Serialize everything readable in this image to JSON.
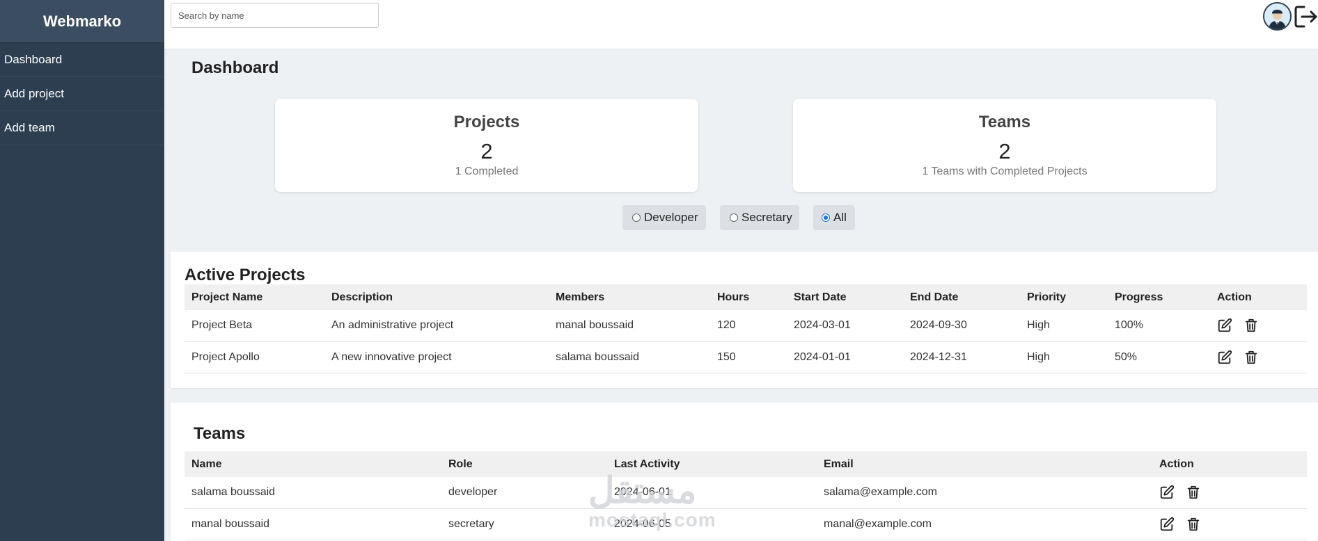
{
  "sidebar": {
    "brand": "Webmarko",
    "items": [
      {
        "label": "Dashboard"
      },
      {
        "label": "Add project"
      },
      {
        "label": "Add team"
      }
    ]
  },
  "header": {
    "search_placeholder": "Search by name",
    "icons": [
      "user-avatar-icon",
      "logout-icon"
    ]
  },
  "main": {
    "title": "Dashboard",
    "cards": {
      "projects": {
        "title": "Projects",
        "count": "2",
        "sub": "1 Completed"
      },
      "teams": {
        "title": "Teams",
        "count": "2",
        "sub": "1 Teams with Completed Projects"
      }
    },
    "filters": [
      {
        "label": "Developer",
        "checked": false
      },
      {
        "label": "Secretary",
        "checked": false
      },
      {
        "label": "All",
        "checked": true
      }
    ],
    "active_projects": {
      "title": "Active Projects",
      "columns": [
        "Project Name",
        "Description",
        "Members",
        "Hours",
        "Start Date",
        "End Date",
        "Priority",
        "Progress",
        "Action"
      ],
      "rows": [
        {
          "name": "Project Beta",
          "description": "An administrative project",
          "members": "manal boussaid",
          "hours": "120",
          "start": "2024-03-01",
          "end": "2024-09-30",
          "priority": "High",
          "progress": "100%"
        },
        {
          "name": "Project Apollo",
          "description": "A new innovative project",
          "members": "salama boussaid",
          "hours": "150",
          "start": "2024-01-01",
          "end": "2024-12-31",
          "priority": "High",
          "progress": "50%"
        }
      ]
    },
    "teams": {
      "title": "Teams",
      "columns": [
        "Name",
        "Role",
        "Last Activity",
        "Email",
        "Action"
      ],
      "rows": [
        {
          "name": "salama boussaid",
          "role": "developer",
          "last_activity": "2024-06-01",
          "email": "salama@example.com"
        },
        {
          "name": "manal boussaid",
          "role": "secretary",
          "last_activity": "2024-06-05",
          "email": "manal@example.com"
        }
      ]
    }
  },
  "watermark": {
    "arabic": "مستقل",
    "latin": "mostaql.com"
  },
  "colors": {
    "sidebar": "#2c3e50",
    "brand_bg": "#3a4d61",
    "main_bg": "#eef1f4",
    "radio_accent": "#1a73e8"
  }
}
